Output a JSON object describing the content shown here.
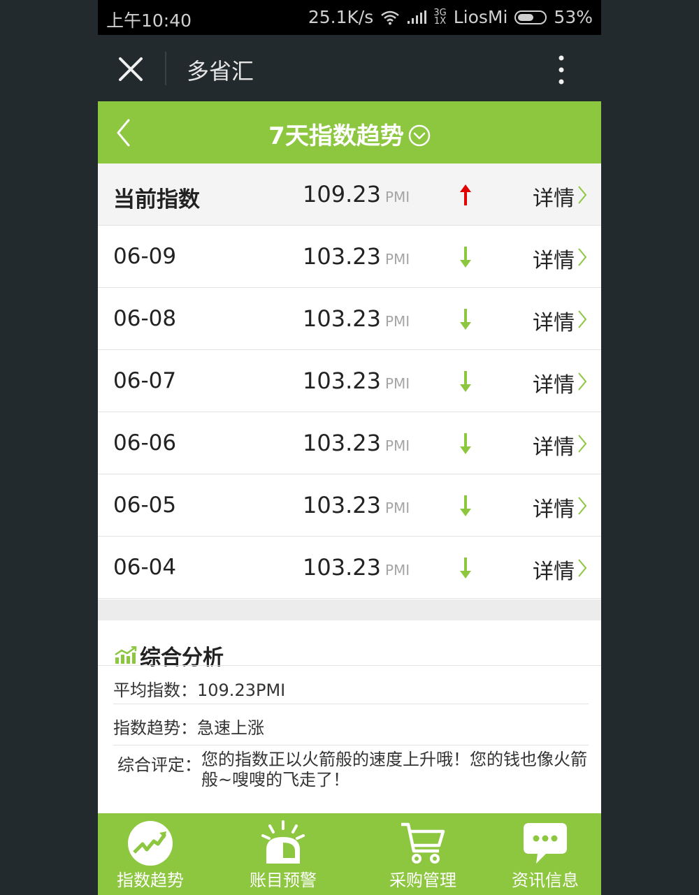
{
  "status_bar": {
    "time": "上午10:40",
    "speed": "25.1K/s",
    "network_top": "3G",
    "network_bottom": "1X",
    "carrier": "LiosMi",
    "battery": "53%"
  },
  "wechat_bar": {
    "title": "多省汇"
  },
  "header": {
    "title": "7天指数趋势"
  },
  "rows": [
    {
      "label": "当前指数",
      "value": "109.23",
      "unit": "PMI",
      "trend": "up",
      "detail": "详情"
    },
    {
      "label": "06-09",
      "value": "103.23",
      "unit": "PMI",
      "trend": "down",
      "detail": "详情"
    },
    {
      "label": "06-08",
      "value": "103.23",
      "unit": "PMI",
      "trend": "down",
      "detail": "详情"
    },
    {
      "label": "06-07",
      "value": "103.23",
      "unit": "PMI",
      "trend": "down",
      "detail": "详情"
    },
    {
      "label": "06-06",
      "value": "103.23",
      "unit": "PMI",
      "trend": "down",
      "detail": "详情"
    },
    {
      "label": "06-05",
      "value": "103.23",
      "unit": "PMI",
      "trend": "down",
      "detail": "详情"
    },
    {
      "label": "06-04",
      "value": "103.23",
      "unit": "PMI",
      "trend": "down",
      "detail": "详情"
    }
  ],
  "analysis": {
    "title": "综合分析",
    "avg_key": "平均指数：",
    "avg_value": "109.23PMI",
    "trend_key": "指数趋势：",
    "trend_value": "急速上涨",
    "eval_key": "综合评定：",
    "eval_value": "您的指数正以火箭般的速度上升哦！您的钱也像火箭般~嗖嗖的飞走了！"
  },
  "nav": [
    {
      "label": "指数趋势",
      "icon": "trend-chart-icon"
    },
    {
      "label": "账目预警",
      "icon": "alarm-light-icon"
    },
    {
      "label": "采购管理",
      "icon": "shopping-cart-icon"
    },
    {
      "label": "资讯信息",
      "icon": "chat-bubble-icon"
    }
  ],
  "colors": {
    "brand_green": "#8dc63f",
    "up_red": "#e00000",
    "down_green": "#8dc63f",
    "dark_bar": "#232a2d"
  }
}
